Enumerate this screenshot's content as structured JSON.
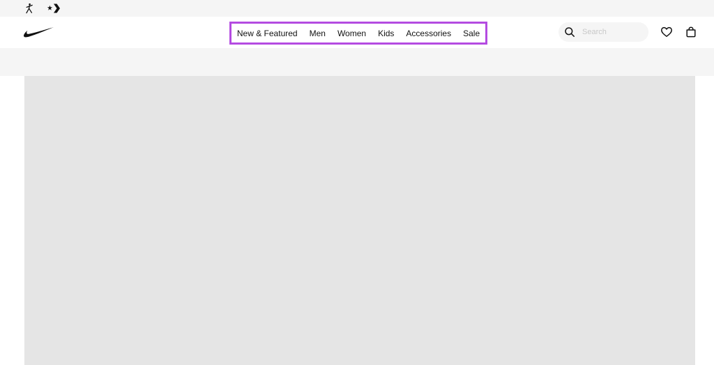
{
  "utility_bar": {
    "brands": [
      {
        "icon": "jordan-jumpman-icon"
      },
      {
        "icon": "converse-star-chevron-icon"
      }
    ]
  },
  "header": {
    "logo_icon": "nike-swoosh-icon",
    "nav": {
      "items": [
        {
          "label": "New & Featured"
        },
        {
          "label": "Men"
        },
        {
          "label": "Women"
        },
        {
          "label": "Kids"
        },
        {
          "label": "Accessories"
        },
        {
          "label": "Sale"
        }
      ],
      "highlight_color": "#b44be1"
    },
    "search": {
      "placeholder": "Search",
      "icon": "search-icon"
    },
    "actions": [
      {
        "icon": "heart-icon"
      },
      {
        "icon": "bag-icon"
      }
    ]
  },
  "colors": {
    "text": "#111111",
    "surface_gray": "#f5f5f5",
    "hero_placeholder": "#e5e5e5"
  }
}
